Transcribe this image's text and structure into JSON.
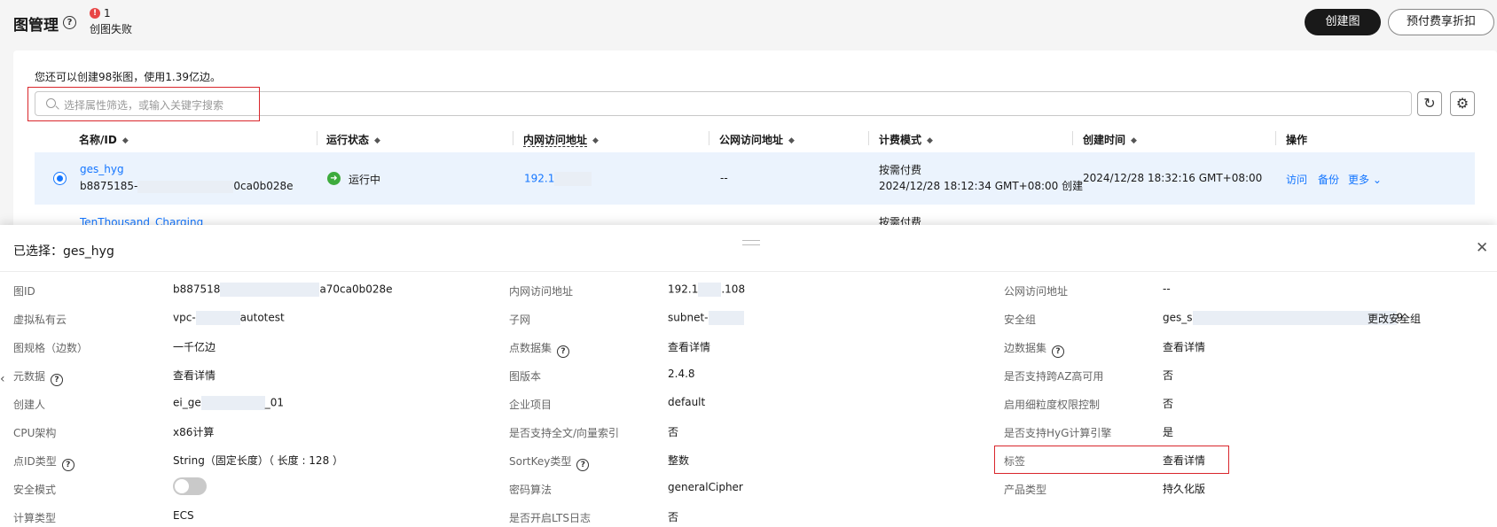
{
  "header": {
    "title": "图管理",
    "fail_count": "1",
    "fail_label": "创图失败",
    "create_button": "创建图",
    "prepaid_button": "预付费享折扣"
  },
  "list": {
    "quota_text": "您还可以创建98张图，使用1.39亿边。",
    "search_placeholder": "选择属性筛选，或输入关键字搜索",
    "columns": [
      "名称/ID",
      "运行状态",
      "内网访问地址",
      "公网访问地址",
      "计费模式",
      "创建时间",
      "操作"
    ],
    "rows": [
      {
        "name": "ges_hyg",
        "id_prefix": "b8875185-",
        "id_suffix": "0ca0b028e",
        "status": "运行中",
        "private_ip": "192.1",
        "public_ip": "--",
        "billing": "按需付费",
        "billing_detail": "2024/12/28 18:12:34 GMT+08:00 创建",
        "created": "2024/12/28 18:32:16 GMT+08:00",
        "actions": [
          "访问",
          "备份",
          "更多"
        ]
      },
      {
        "name": "TenThousand_Charging",
        "billing": "按需付费"
      }
    ]
  },
  "detail": {
    "selected_title": "已选择：ges_hyg",
    "col1": [
      {
        "label": "图ID",
        "value": "b887518",
        "value_suffix": "a70ca0b028e"
      },
      {
        "label": "虚拟私有云",
        "value": "vpc-",
        "value_suffix": "autotest"
      },
      {
        "label": "图规格（边数）",
        "value": "一千亿边"
      },
      {
        "label": "元数据",
        "value": "查看详情"
      },
      {
        "label": "创建人",
        "value": "ei_ge",
        "value_suffix": "_01"
      },
      {
        "label": "CPU架构",
        "value": "x86计算"
      },
      {
        "label": "点ID类型",
        "value": "String（固定长度）（ 长度 : 128 ）"
      },
      {
        "label": "安全模式",
        "value": ""
      },
      {
        "label": "计算类型",
        "value": "ECS"
      }
    ],
    "col2": [
      {
        "label": "内网访问地址",
        "value": "192.1",
        "value_suffix": ".108"
      },
      {
        "label": "子网",
        "value": "subnet-"
      },
      {
        "label": "点数据集",
        "value": "查看详情"
      },
      {
        "label": "图版本",
        "value": "2.4.8"
      },
      {
        "label": "企业项目",
        "value": "default"
      },
      {
        "label": "是否支持全文/向量索引",
        "value": "否"
      },
      {
        "label": "SortKey类型",
        "value": "整数"
      },
      {
        "label": "密码算法",
        "value": "generalCipher"
      },
      {
        "label": "是否开启LTS日志",
        "value": "否"
      }
    ],
    "col3": [
      {
        "label": "公网访问地址",
        "value": "--"
      },
      {
        "label": "安全组",
        "value": "ges_s",
        "value_suffix": "9",
        "action": "更改安全组"
      },
      {
        "label": "边数据集",
        "value": "查看详情"
      },
      {
        "label": "是否支持跨AZ高可用",
        "value": "否"
      },
      {
        "label": "启用细粒度权限控制",
        "value": "否"
      },
      {
        "label": "是否支持HyG计算引擎",
        "value": "是"
      },
      {
        "label": "标签",
        "value": "查看详情"
      },
      {
        "label": "产品类型",
        "value": "持久化版"
      }
    ]
  },
  "colors": {
    "accent": "#1476ff",
    "primary_button": "#191919",
    "highlight_border": "#d9262b",
    "running": "#3dab3d",
    "selected_row": "#ebf3fd"
  }
}
